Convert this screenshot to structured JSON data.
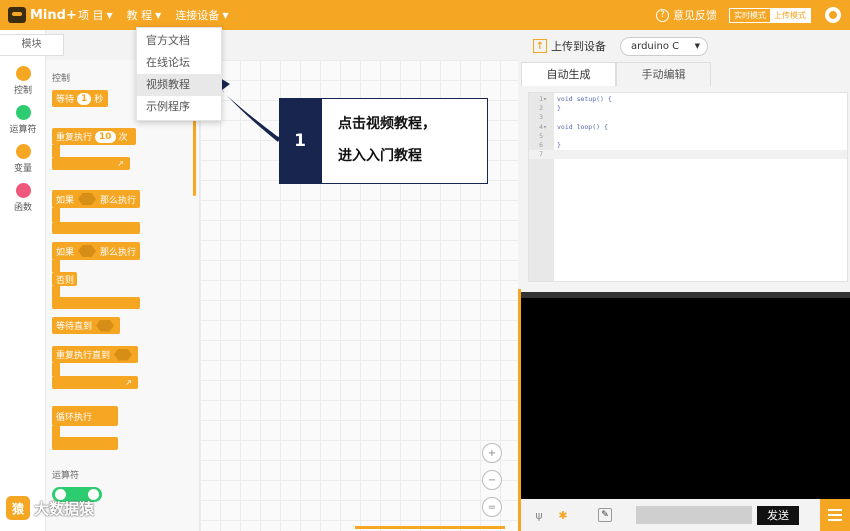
{
  "topbar": {
    "logo": "Mind+",
    "menu": [
      "项 目",
      "教 程",
      "连接设备"
    ],
    "feedback": "意见反馈",
    "mode_realtime": "实时模式",
    "mode_upload": "上传模式"
  },
  "dropdown": {
    "items": [
      "官方文档",
      "在线论坛",
      "视频教程",
      "示例程序"
    ],
    "active_index": 2
  },
  "sidebar": {
    "blocks_tab": "模块",
    "categories": [
      {
        "label": "控制",
        "color": "#f5a623"
      },
      {
        "label": "运算符",
        "color": "#2ecc71"
      },
      {
        "label": "变量",
        "color": "#f5a623"
      },
      {
        "label": "函数",
        "color": "#f0577d"
      }
    ]
  },
  "palette": {
    "section_control": "控制",
    "wait": "等待",
    "wait_value": "1",
    "seconds": "秒",
    "repeat": "重复执行",
    "repeat_value": "10",
    "times": "次",
    "if_label": "如果",
    "then_label": "那么执行",
    "if2_label": "如果",
    "then2_label": "那么执行",
    "else_label": "否则",
    "wait_until": "等待直到",
    "repeat_until": "重复执行直到",
    "forever": "循环执行",
    "section_operators": "运算符",
    "toggle_plus": "+"
  },
  "right_panel": {
    "upload_label": "上传到设备",
    "board": "arduino C",
    "tabs": [
      "自动生成",
      "手动编辑"
    ],
    "active_tab": 0,
    "code_lines": [
      {
        "n": "1",
        "fold": "▾",
        "src": "void setup() {"
      },
      {
        "n": "2",
        "fold": "",
        "src": "}"
      },
      {
        "n": "3",
        "fold": "",
        "src": ""
      },
      {
        "n": "4",
        "fold": "▾",
        "src": "void loop() {"
      },
      {
        "n": "5",
        "fold": "",
        "src": ""
      },
      {
        "n": "6",
        "fold": "",
        "src": "}"
      },
      {
        "n": "7",
        "fold": "",
        "src": ""
      }
    ],
    "send_label": "发送"
  },
  "zoom": {
    "zoom_in": "+",
    "zoom_out": "−",
    "reset": "="
  },
  "callout": {
    "number": "1",
    "line1": "点击视频教程，",
    "line2": "进入入门教程"
  },
  "watermark": {
    "text": "大数据猿",
    "icon": "猿"
  },
  "colors": {
    "accent": "#f5a623",
    "callout": "#17254f"
  }
}
